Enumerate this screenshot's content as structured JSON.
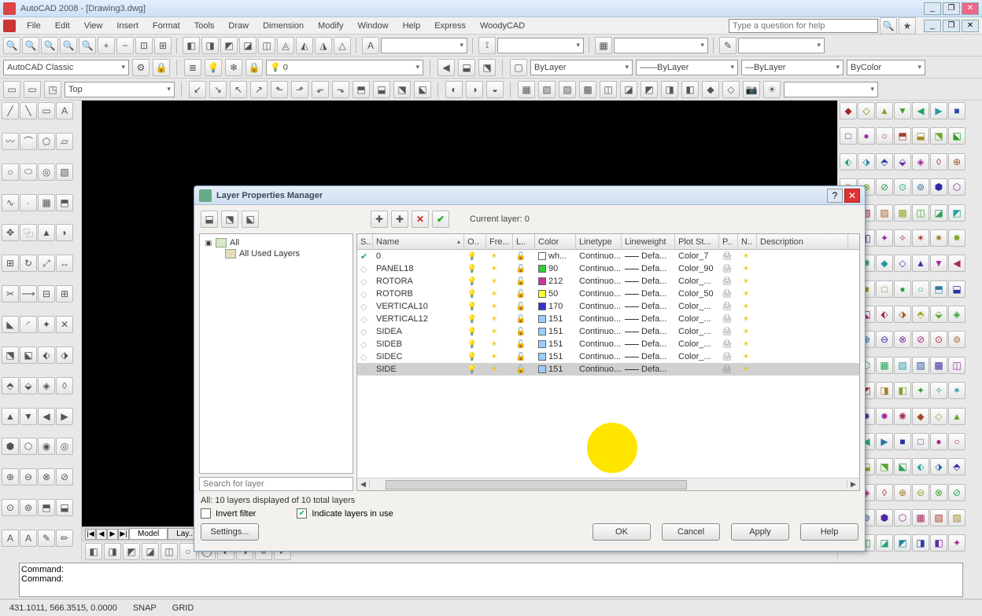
{
  "app": {
    "title": "AutoCAD 2008 - [Drawing3.dwg]"
  },
  "menu": {
    "items": [
      "File",
      "Edit",
      "View",
      "Insert",
      "Format",
      "Tools",
      "Draw",
      "Dimension",
      "Modify",
      "Window",
      "Help",
      "Express",
      "WoodyCAD"
    ],
    "help_placeholder": "Type a question for help"
  },
  "workspace": {
    "combo": "AutoCAD Classic",
    "view": "Top"
  },
  "layer_toolbar": {
    "current": "0",
    "bylayer1": "ByLayer",
    "bylayer2": "ByLayer",
    "bylayer3": "ByLayer",
    "bycolor": "ByColor"
  },
  "model_tabs": {
    "active": "Model",
    "other": "Lay..."
  },
  "command": {
    "line1": "Command:",
    "line2": "Command:"
  },
  "status": {
    "coords": "431.1011, 566.3515, 0.0000",
    "snap": "SNAP",
    "grid": "GRID"
  },
  "dialog": {
    "title": "Layer Properties Manager",
    "current_layer_label": "Current layer: 0",
    "tree": {
      "root": "All",
      "child": "All Used Layers",
      "search_ph": "Search for layer"
    },
    "columns": {
      "s": "S..",
      "name": "Name",
      "on": "O..",
      "fre": "Fre...",
      "lock": "L..",
      "color": "Color",
      "ltype": "Linetype",
      "lw": "Lineweight",
      "plot": "Plot St...",
      "p": "P..",
      "n": "N..",
      "desc": "Description"
    },
    "rows": [
      {
        "name": "0",
        "color_sw": "#ffffff",
        "color": "wh...",
        "ltype": "Continuo...",
        "lw": "Defa...",
        "plot": "Color_7",
        "sel": false,
        "current": true
      },
      {
        "name": "PANEL18",
        "color_sw": "#33cc33",
        "color": "90",
        "ltype": "Continuo...",
        "lw": "Defa...",
        "plot": "Color_90",
        "sel": false,
        "current": false
      },
      {
        "name": "ROTORA",
        "color_sw": "#cc3399",
        "color": "212",
        "ltype": "Continuo...",
        "lw": "Defa...",
        "plot": "Color_...",
        "sel": false,
        "current": false
      },
      {
        "name": "ROTORB",
        "color_sw": "#ffff33",
        "color": "50",
        "ltype": "Continuo...",
        "lw": "Defa...",
        "plot": "Color_50",
        "sel": false,
        "current": false
      },
      {
        "name": "VERTICAL10",
        "color_sw": "#3333cc",
        "color": "170",
        "ltype": "Continuo...",
        "lw": "Defa...",
        "plot": "Color_...",
        "sel": false,
        "current": false
      },
      {
        "name": "VERTICAL12",
        "color_sw": "#99ccff",
        "color": "151",
        "ltype": "Continuo...",
        "lw": "Defa...",
        "plot": "Color_...",
        "sel": false,
        "current": false
      },
      {
        "name": "SIDEA",
        "color_sw": "#99ccff",
        "color": "151",
        "ltype": "Continuo...",
        "lw": "Defa...",
        "plot": "Color_...",
        "sel": false,
        "current": false
      },
      {
        "name": "SIDEB",
        "color_sw": "#99ccff",
        "color": "151",
        "ltype": "Continuo...",
        "lw": "Defa...",
        "plot": "Color_...",
        "sel": false,
        "current": false
      },
      {
        "name": "SIDEC",
        "color_sw": "#99ccff",
        "color": "151",
        "ltype": "Continuo...",
        "lw": "Defa...",
        "plot": "Color_...",
        "sel": false,
        "current": false
      },
      {
        "name": "SIDE",
        "color_sw": "#99ccff",
        "color": "151",
        "ltype": "Continuo...",
        "lw": "Defa...",
        "plot": "",
        "sel": true,
        "current": false
      }
    ],
    "status_line": "All: 10 layers displayed of 10 total layers",
    "invert_filter": "Invert filter",
    "indicate": "Indicate layers in use",
    "settings_btn": "Settings...",
    "ok": "OK",
    "cancel": "Cancel",
    "apply": "Apply",
    "help": "Help"
  }
}
